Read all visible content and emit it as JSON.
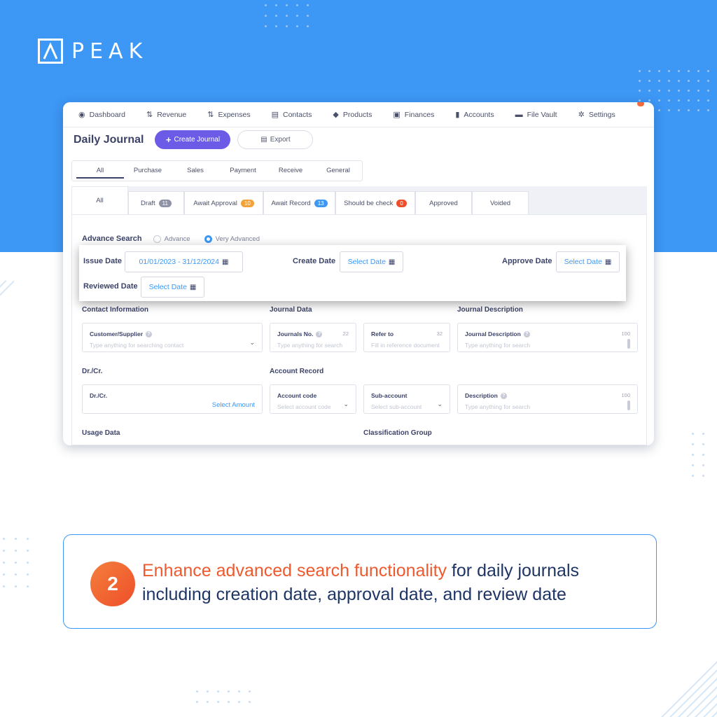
{
  "brand": {
    "name": "PEAK"
  },
  "nav": [
    {
      "label": "Dashboard",
      "icon": "dashboard-icon"
    },
    {
      "label": "Revenue",
      "icon": "revenue-icon"
    },
    {
      "label": "Expenses",
      "icon": "expenses-icon"
    },
    {
      "label": "Contacts",
      "icon": "contacts-icon"
    },
    {
      "label": "Products",
      "icon": "products-icon"
    },
    {
      "label": "Finances",
      "icon": "finances-icon"
    },
    {
      "label": "Accounts",
      "icon": "accounts-icon"
    },
    {
      "label": "File Vault",
      "icon": "folder-icon"
    },
    {
      "label": "Settings",
      "icon": "gear-icon"
    }
  ],
  "page": {
    "title": "Daily Journal",
    "create_label": "Create Journal",
    "export_label": "Export"
  },
  "type_tabs": [
    "All",
    "Purchase",
    "Sales",
    "Payment",
    "Receive",
    "General"
  ],
  "status_tabs": [
    {
      "label": "All",
      "count": "",
      "color": ""
    },
    {
      "label": "Draft",
      "count": "11",
      "color": "#8e93a6"
    },
    {
      "label": "Await Approval",
      "count": "10",
      "color": "#f3a23a"
    },
    {
      "label": "Await Record",
      "count": "13",
      "color": "#3d97f5"
    },
    {
      "label": "Should be check",
      "count": "0",
      "color": "#ee4f2a"
    },
    {
      "label": "Approved",
      "count": "",
      "color": ""
    },
    {
      "label": "Voided",
      "count": "",
      "color": ""
    }
  ],
  "search": {
    "label": "Advance Search",
    "option_advance": "Advance",
    "option_very_advanced": "Very Advanced",
    "issue_date_label": "Issue Date",
    "issue_date_value": "01/01/2023 - 31/12/2024",
    "create_date_label": "Create Date",
    "approve_date_label": "Approve Date",
    "reviewed_date_label": "Reviewed Date",
    "select_date": "Select Date"
  },
  "sections": {
    "contact_info": "Contact Information",
    "journal_data": "Journal Data",
    "journal_description": "Journal Description",
    "drcr": "Dr./Cr.",
    "account_record": "Account Record",
    "usage_data": "Usage Data",
    "classification_group": "Classification Group"
  },
  "fields": {
    "customer_label": "Customer/Supplier",
    "customer_ph": "Type anything for searching contact",
    "journals_no_label": "Journals No.",
    "journals_no_count": "22",
    "journals_no_ph": "Type anything for search",
    "refer_label": "Refer to",
    "refer_count": "32",
    "refer_ph": "Fill in reference document",
    "jdesc_label": "Journal Description",
    "jdesc_count": "100",
    "jdesc_ph": "Type anything for search",
    "drcr_label": "Dr./Cr.",
    "select_amount": "Select Amount",
    "account_code_label": "Account code",
    "account_code_ph": "Select account code",
    "subaccount_label": "Sub-account",
    "subaccount_ph": "Select sub-account",
    "desc_label": "Description",
    "desc_count": "100",
    "desc_ph": "Type anything for search"
  },
  "caption": {
    "number": "2",
    "highlight": "Enhance advanced search functionality",
    "rest_line1": " for daily journals",
    "line2": "including creation date, approval date, and review date"
  },
  "colors": {
    "brand_blue": "#3d97f5",
    "primary_button": "#6b5be6",
    "accent_orange": "#ee5a2e",
    "navy_text": "#1e3566"
  }
}
